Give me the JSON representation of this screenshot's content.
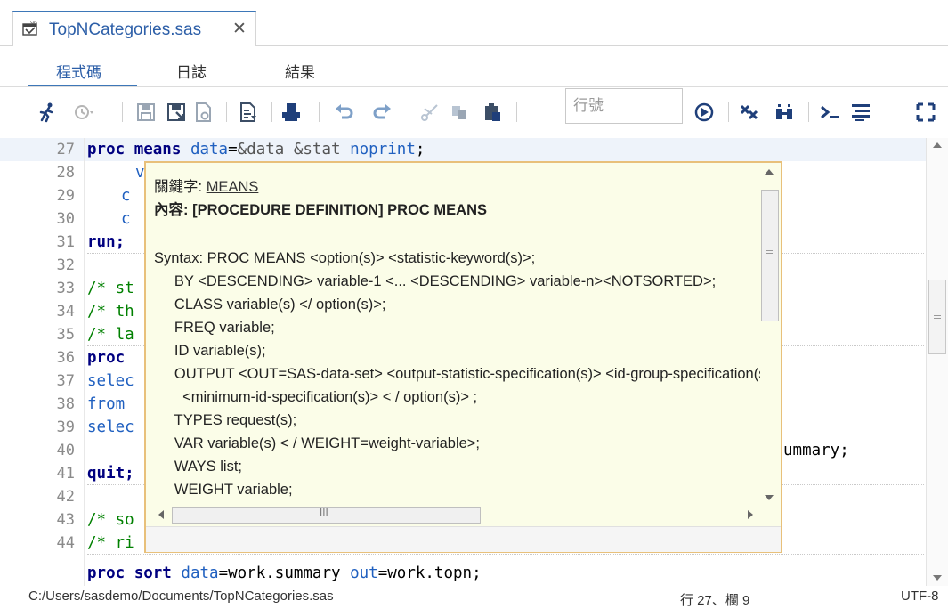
{
  "tab": {
    "filename": "TopNCategories.sas",
    "close": "✕"
  },
  "subtabs": [
    "程式碼",
    "日誌",
    "結果"
  ],
  "toolbar": {
    "line_placeholder": "行號",
    "icons": [
      "run-icon",
      "history-icon",
      "save-icon",
      "save-as-icon",
      "template-icon",
      "format-code-icon",
      "print-icon",
      "undo-icon",
      "redo-icon",
      "cut-icon",
      "copy-icon",
      "paste-icon",
      "go-icon",
      "clear-icon",
      "split-icon",
      "submit-selection-icon",
      "outline-icon",
      "maximize-icon"
    ]
  },
  "editor": {
    "line_numbers": [
      "27",
      "28",
      "29",
      "30",
      "31",
      "32",
      "33",
      "34",
      "35",
      "36",
      "37",
      "38",
      "39",
      "40",
      "41",
      "42",
      "43",
      "44"
    ],
    "lines": {
      "l27": {
        "kw1": "proc",
        "kw2": "means",
        "opt": "data",
        "eq": "=",
        "mac": "&data",
        "sp": " ",
        "mac2": "&stat",
        "sp2": " ",
        "opt2": "noprint",
        "end": ";"
      },
      "l28": "v",
      "l29": "c",
      "l30": "c",
      "l31": "run;",
      "l33": "/* st",
      "l34": "/* th",
      "l35": "/* la",
      "l36": "proc",
      "l37": "selec",
      "l38": "from",
      "l39a": "selec",
      "l39b": "ummary;",
      "l40": "quit;",
      "l42": "/* so",
      "l43": "/* ri",
      "l44": {
        "kw1": "proc",
        "kw2": "sort",
        "opt": "data",
        "eq": "=",
        "v1": "work.summary",
        "opt2": "out",
        "eq2": "=",
        "v2": "work.topn",
        "end": ";"
      }
    }
  },
  "tooltip": {
    "keyword_label": "關鍵字:",
    "keyword": "MEANS",
    "content_label": "內容:",
    "content": "[PROCEDURE DEFINITION] PROC MEANS",
    "syntax_lines": [
      "Syntax: PROC MEANS <option(s)> <statistic-keyword(s)>;",
      "     BY <DESCENDING> variable-1 <... <DESCENDING> variable-n><NOTSORTED>;",
      "     CLASS variable(s) </ option(s)>;",
      "     FREQ variable;",
      "     ID variable(s);",
      "     OUTPUT <OUT=SAS-data-set> <output-statistic-specification(s)> <id-group-specification(s)>",
      "       <minimum-id-specification(s)> < / option(s)> ;",
      "     TYPES request(s);",
      "     VAR variable(s) < / WEIGHT=weight-variable>;",
      "     WAYS list;",
      "     WEIGHT variable;"
    ],
    "hscroll_grip": "III"
  },
  "status": {
    "path": "C:/Users/sasdemo/Documents/TopNCategories.sas",
    "position": "行 27、欄 9",
    "encoding": "UTF-8"
  },
  "colors": {
    "accent": "#3d77b8",
    "tooltip_bg": "#fbfde8",
    "tooltip_border": "#e8c07a",
    "keyword": "#000080",
    "option": "#2060c0",
    "comment": "#008000"
  }
}
